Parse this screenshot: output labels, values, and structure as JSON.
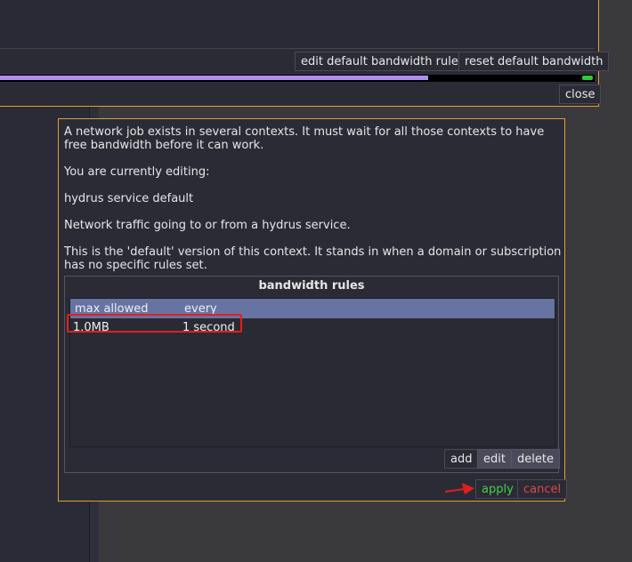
{
  "background": {
    "buttons": {
      "edit_default": "edit default bandwidth rules",
      "reset_default": "reset default bandwidth",
      "close": "close"
    },
    "progress_fraction": 0.72
  },
  "dialog": {
    "paragraphs": [
      "A network job exists in several contexts. It must wait for all those contexts to have",
      "free bandwidth before it can work.",
      "You are currently editing:",
      "hydrus service default",
      "Network traffic going to or from a hydrus service.",
      "This is the 'default' version of this context. It stands in when a domain or subscription",
      "has no specific rules set."
    ],
    "group_title": "bandwidth rules",
    "table": {
      "columns": [
        "max allowed",
        "every"
      ],
      "rows": [
        [
          "1.0MB",
          "1 second"
        ]
      ]
    },
    "buttons": {
      "add": "add",
      "edit": "edit",
      "delete": "delete",
      "apply": "apply",
      "cancel": "cancel"
    },
    "colors": {
      "apply": "#43d04a",
      "cancel": "#e24646",
      "highlight": "#e02020",
      "accent": "#e0a030"
    }
  }
}
